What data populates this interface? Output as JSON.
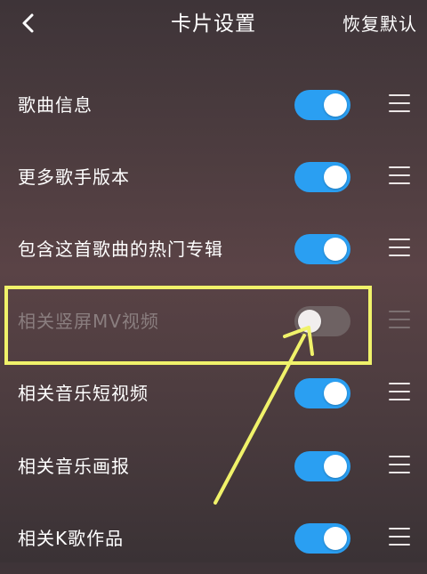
{
  "header": {
    "title": "卡片设置",
    "restore_label": "恢复默认",
    "back_icon": "chevron-left-icon"
  },
  "colors": {
    "toggle_on": "#2a9ff2",
    "toggle_off": "#6e6263",
    "annotation": "#f0f26a"
  },
  "settings": [
    {
      "label": "歌曲信息",
      "enabled": true
    },
    {
      "label": "更多歌手版本",
      "enabled": true
    },
    {
      "label": "包含这首歌曲的热门专辑",
      "enabled": true
    },
    {
      "label": "相关竖屏MV视频",
      "enabled": false
    },
    {
      "label": "相关音乐短视频",
      "enabled": true
    },
    {
      "label": "相关音乐画报",
      "enabled": true
    },
    {
      "label": "相关K歌作品",
      "enabled": true
    }
  ]
}
